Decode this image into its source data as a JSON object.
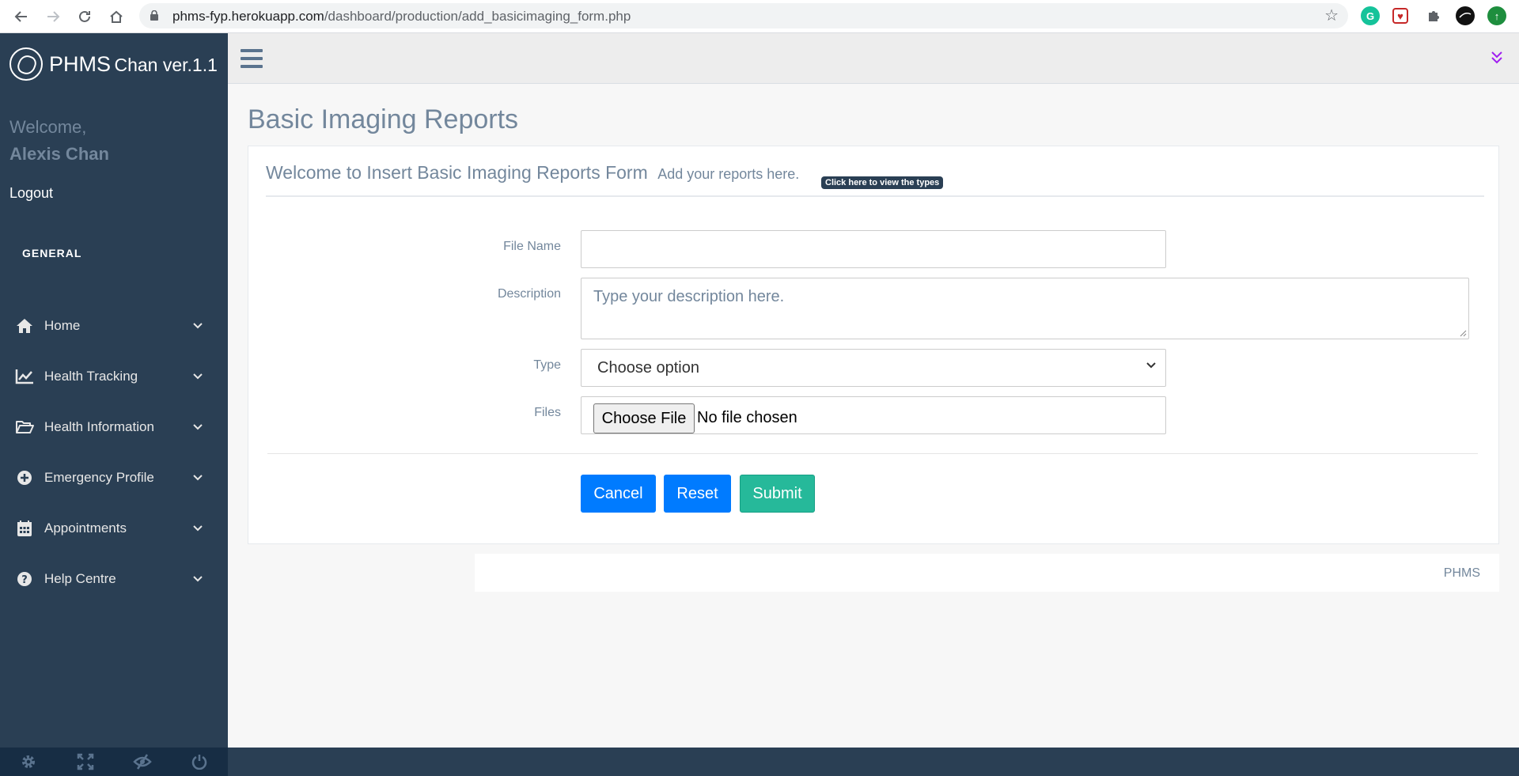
{
  "browser": {
    "url_host": "phms-fyp.herokuapp.com",
    "url_path": "/dashboard/production/add_basicimaging_form.php"
  },
  "sidebar": {
    "brand_main": "PHMS",
    "brand_sub": "Chan ver.1.1",
    "welcome": "Welcome,",
    "user_name": "Alexis Chan",
    "logout": "Logout",
    "section_title": "GENERAL",
    "items": [
      {
        "label": "Home",
        "icon": "home-icon"
      },
      {
        "label": "Health Tracking",
        "icon": "line-chart-icon"
      },
      {
        "label": "Health Information",
        "icon": "folder-open-icon"
      },
      {
        "label": "Emergency Profile",
        "icon": "plus-circle-icon"
      },
      {
        "label": "Appointments",
        "icon": "calendar-icon"
      },
      {
        "label": "Help Centre",
        "icon": "question-circle-icon"
      }
    ],
    "footer_icons": [
      "settings-icon",
      "fullscreen-icon",
      "eye-slash-icon",
      "power-icon"
    ]
  },
  "page": {
    "title": "Basic Imaging Reports"
  },
  "panel": {
    "title": "Welcome to Insert Basic Imaging Reports Form",
    "subtitle": "Add your reports here.",
    "badge": "Click here to view the types"
  },
  "form": {
    "file_name_label": "File Name",
    "file_name_value": "",
    "description_label": "Description",
    "description_placeholder": "Type your description here.",
    "type_label": "Type",
    "type_value": "Choose option",
    "files_label": "Files",
    "choose_file": "Choose File",
    "file_status": "No file chosen"
  },
  "buttons": {
    "cancel": "Cancel",
    "reset": "Reset",
    "submit": "Submit"
  },
  "footer": {
    "text": "PHMS"
  },
  "colors": {
    "sidebar": "#2a3f54",
    "primary": "#007bff",
    "success": "#26b99a",
    "text_muted": "#73879c"
  }
}
